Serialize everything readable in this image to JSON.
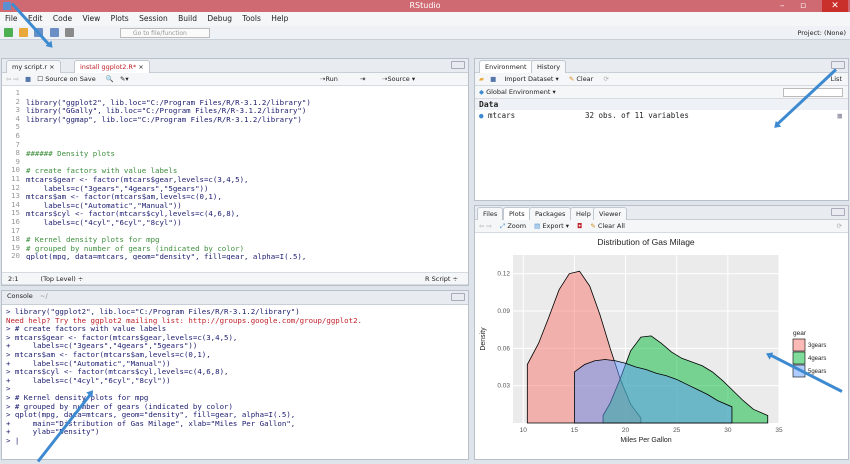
{
  "window": {
    "title": "RStudio",
    "min_label": "–",
    "max_label": "▫",
    "close_label": "✕"
  },
  "menu": [
    "File",
    "Edit",
    "Code",
    "View",
    "Plots",
    "Session",
    "Build",
    "Debug",
    "Tools",
    "Help"
  ],
  "toolbar": {
    "goto_placeholder": "Go to file/function",
    "project_label": "Project: (None)"
  },
  "editor": {
    "tabs": [
      "my script.r",
      "install ggplot2.R*"
    ],
    "source_on_save": "Source on Save",
    "run_label": "Run",
    "source_label": "Source",
    "lines": [
      {
        "n": "1",
        "text": ""
      },
      {
        "n": "2",
        "text": "library(\"ggplot2\", lib.loc=\"C:/Program Files/R/R-3.1.2/library\")"
      },
      {
        "n": "3",
        "text": "library(\"GGally\", lib.loc=\"C:/Program Files/R/R-3.1.2/library\")"
      },
      {
        "n": "4",
        "text": "library(\"ggmap\", lib.loc=\"C:/Program Files/R/R-3.1.2/library\")"
      },
      {
        "n": "5",
        "text": ""
      },
      {
        "n": "6",
        "text": ""
      },
      {
        "n": "7",
        "text": ""
      },
      {
        "n": "8",
        "text": "###### Density plots"
      },
      {
        "n": "9",
        "text": ""
      },
      {
        "n": "10",
        "text": "# create factors with value labels"
      },
      {
        "n": "11",
        "text": "mtcars$gear <- factor(mtcars$gear,levels=c(3,4,5),"
      },
      {
        "n": "12",
        "text": "    labels=c(\"3gears\",\"4gears\",\"5gears\"))"
      },
      {
        "n": "13",
        "text": "mtcars$am <- factor(mtcars$am,levels=c(0,1),"
      },
      {
        "n": "14",
        "text": "    labels=c(\"Automatic\",\"Manual\"))"
      },
      {
        "n": "15",
        "text": "mtcars$cyl <- factor(mtcars$cyl,levels=c(4,6,8),"
      },
      {
        "n": "16",
        "text": "    labels=c(\"4cyl\",\"6cyl\",\"8cyl\"))"
      },
      {
        "n": "17",
        "text": ""
      },
      {
        "n": "18",
        "text": "# Kernel density plots for mpg"
      },
      {
        "n": "19",
        "text": "# grouped by number of gears (indicated by color)"
      },
      {
        "n": "20",
        "text": "qplot(mpg, data=mtcars, geom=\"density\", fill=gear, alpha=I(.5),"
      }
    ],
    "status_pos": "2:1",
    "status_level": "(Top Level) ÷",
    "status_type": "R Script ÷"
  },
  "console": {
    "title": "Console",
    "path": "~/",
    "lines": [
      {
        "text": "> library(\"ggplot2\", lib.loc=\"C:/Program Files/R/R-3.1.2/library\")",
        "err": false
      },
      {
        "text": "Need help? Try the ggplot2 mailing list: http://groups.google.com/group/ggplot2.",
        "err": true
      },
      {
        "text": "> # create factors with value labels",
        "err": false
      },
      {
        "text": "> mtcars$gear <- factor(mtcars$gear,levels=c(3,4,5),",
        "err": false
      },
      {
        "text": "+     labels=c(\"3gears\",\"4gears\",\"5gears\"))",
        "err": false
      },
      {
        "text": "> mtcars$am <- factor(mtcars$am,levels=c(0,1),",
        "err": false
      },
      {
        "text": "+     labels=c(\"Automatic\",\"Manual\"))",
        "err": false
      },
      {
        "text": "> mtcars$cyl <- factor(mtcars$cyl,levels=c(4,6,8),",
        "err": false
      },
      {
        "text": "+     labels=c(\"4cyl\",\"6cyl\",\"8cyl\"))",
        "err": false
      },
      {
        "text": ">",
        "err": false
      },
      {
        "text": "> # Kernel density plots for mpg",
        "err": false
      },
      {
        "text": "> # grouped by number of gears (indicated by color)",
        "err": false
      },
      {
        "text": "> qplot(mpg, data=mtcars, geom=\"density\", fill=gear, alpha=I(.5),",
        "err": false
      },
      {
        "text": "+     main=\"Distribution of Gas Milage\", xlab=\"Miles Per Gallon\",",
        "err": false
      },
      {
        "text": "+     ylab=\"Density\")",
        "err": false
      },
      {
        "text": "> |",
        "err": false
      }
    ]
  },
  "environment": {
    "tabs": [
      "Environment",
      "History"
    ],
    "import_label": "Import Dataset ▾",
    "clear_label": "Clear",
    "global_env": "Global Environment ▾",
    "list_label": "List",
    "section": "Data",
    "rows": [
      {
        "name": "mtcars",
        "desc": "32 obs. of 11 variables"
      }
    ]
  },
  "plots": {
    "tabs": [
      "Files",
      "Plots",
      "Packages",
      "Help",
      "Viewer"
    ],
    "zoom_label": "Zoom",
    "export_label": "Export ▾",
    "clear_all_label": "Clear All"
  },
  "chart_data": {
    "type": "area",
    "title": "Distribution of Gas Milage",
    "xlabel": "Miles Per Gallon",
    "ylabel": "Density",
    "xlim": [
      9,
      35
    ],
    "ylim": [
      0,
      0.135
    ],
    "xticks": [
      10,
      15,
      20,
      25,
      30,
      35
    ],
    "yticks": [
      0.03,
      0.06,
      0.09,
      0.12
    ],
    "legend_title": "gear",
    "legend_position": "right",
    "grid": true,
    "series": [
      {
        "name": "3gears",
        "color": "#f8766d",
        "x": [
          10.4,
          11.5,
          12.5,
          13.5,
          14.5,
          15.5,
          16.5,
          17.5,
          18.5,
          19.5,
          20.5,
          21.5
        ],
        "y": [
          0.047,
          0.064,
          0.085,
          0.107,
          0.12,
          0.122,
          0.11,
          0.087,
          0.06,
          0.035,
          0.015,
          0.004
        ]
      },
      {
        "name": "4gears",
        "color": "#00ba38",
        "x": [
          17.8,
          18.5,
          19.5,
          20.5,
          21.5,
          22.5,
          23.5,
          24.5,
          25.5,
          26.5,
          27.5,
          28.5,
          29.5,
          30.5,
          31.5,
          32.5,
          33.9
        ],
        "y": [
          0.006,
          0.016,
          0.036,
          0.058,
          0.069,
          0.07,
          0.064,
          0.057,
          0.052,
          0.049,
          0.046,
          0.041,
          0.034,
          0.026,
          0.018,
          0.011,
          0.006
        ]
      },
      {
        "name": "5gears",
        "color": "#619cff",
        "x": [
          15,
          16,
          17,
          18,
          19,
          20,
          21,
          22,
          23,
          24,
          25,
          26,
          27,
          28,
          29,
          30.4
        ],
        "y": [
          0.041,
          0.047,
          0.05,
          0.051,
          0.05,
          0.048,
          0.045,
          0.043,
          0.04,
          0.038,
          0.035,
          0.031,
          0.027,
          0.023,
          0.018,
          0.013
        ]
      }
    ]
  }
}
